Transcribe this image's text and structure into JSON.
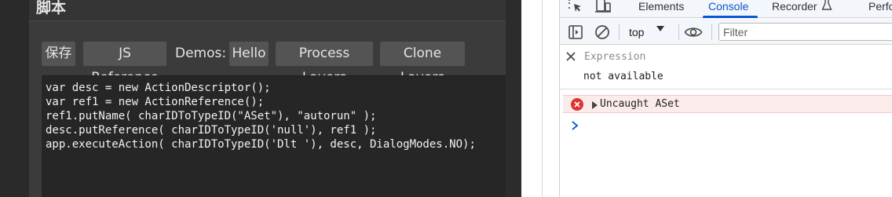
{
  "script_panel": {
    "title": "脚本",
    "toolbar": {
      "save_label": "保存",
      "js_reference_label": "JS Reference",
      "demos_label": "Demos:",
      "hello_label": "Hello",
      "process_layers_label": "Process Layers",
      "clone_layers_label": "Clone Layers"
    },
    "code_lines": [
      "var desc = new ActionDescriptor();",
      "var ref1 = new ActionReference();",
      "ref1.putName( charIDToTypeID(\"ASet\"), \"autorun\" );",
      "desc.putReference( charIDToTypeID('null'), ref1 );",
      "app.executeAction( charIDToTypeID('Dlt '), desc, DialogModes.NO);"
    ]
  },
  "devtools": {
    "tabs": [
      "Elements",
      "Console",
      "Recorder",
      "Performance"
    ],
    "active_tab": "Console",
    "context_selector": "top",
    "filter_placeholder": "Filter",
    "live_expression": {
      "label": "Expression",
      "value": "not available"
    },
    "error_message": "Uncaught ASet",
    "icons": {
      "inspect": "inspect-element-icon",
      "device": "device-toolbar-icon",
      "sidebar": "show-sidebar-icon",
      "clear": "clear-console-icon",
      "eye": "live-expression-eye-icon",
      "close": "close-icon",
      "error": "error-icon",
      "expand": "expand-triangle-icon",
      "prompt": "console-prompt-icon",
      "flask": "flask-icon"
    },
    "colors": {
      "accent": "#0b57d0",
      "error_bg": "#fcebeb",
      "error_icon": "#dc362e"
    }
  }
}
